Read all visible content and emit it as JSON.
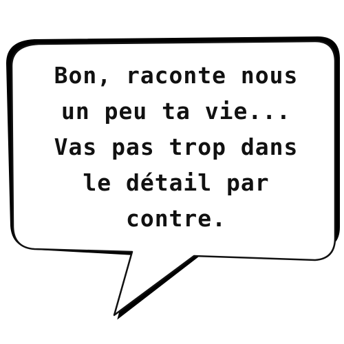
{
  "speech_bubble": {
    "lines": [
      "Bon, raconte nous",
      "un peu ta vie...",
      "Vas pas trop dans",
      "le détail par",
      "contre."
    ],
    "fill_color": "#ffffff",
    "outline_color": "#111111",
    "shadow_color": "#000000",
    "text_color": "#111111"
  }
}
